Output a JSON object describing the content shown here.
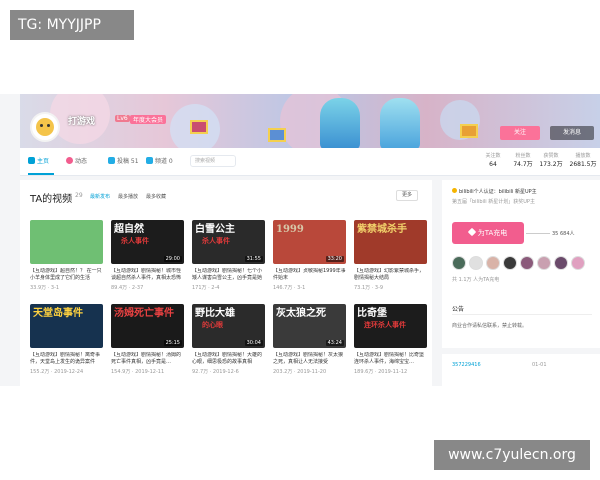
{
  "overlays": {
    "tag_top": "TG: MYYJJPP",
    "tag_bottom": "www.c7yulecn.org"
  },
  "profile": {
    "name": "打游戏",
    "level": "Lv6",
    "vip": "年度大会员",
    "follow_label": "关注",
    "message_label": "发消息"
  },
  "nav": {
    "items": [
      {
        "label": "主页",
        "color": "#00a1d6"
      },
      {
        "label": "动态",
        "color": "#f25d8e"
      },
      {
        "label": "投稿 51",
        "color": "#23ade5"
      },
      {
        "label": "频道 0",
        "color": "#23ade5"
      }
    ],
    "search_placeholder": "搜索视频",
    "stats": [
      {
        "label": "关注数",
        "value": "64"
      },
      {
        "label": "粉丝数",
        "value": "74.7万"
      },
      {
        "label": "获赞数",
        "value": "173.2万"
      },
      {
        "label": "播放数",
        "value": "2681.5万"
      }
    ]
  },
  "videos": {
    "title": "TA的视频",
    "count": "29",
    "sort": [
      "最新发布",
      "最多播放",
      "最多收藏"
    ],
    "more": "更多",
    "items": [
      {
        "thumb_title": "",
        "thumb_sub": "",
        "bg": "#6fbf73",
        "fg": "#ffffff",
        "duration": "",
        "title": "【互动游戏】超自然！？ 在一只小羊身体里成了它们的生活",
        "meta": "33.9万 · 3-1"
      },
      {
        "thumb_title": "超自然",
        "thumb_sub": "杀人事件",
        "bg": "#1c1c1c",
        "fg": "#ffffff",
        "duration": "29:00",
        "title": "【互动游戏】剧情揭秘！城市怪谈超自然杀人事件，真相太恐怖",
        "meta": "89.4万 · 2-37"
      },
      {
        "thumb_title": "白雪公主",
        "thumb_sub": "杀人事件",
        "bg": "#2a2a2a",
        "fg": "#ffffff",
        "duration": "31:55",
        "title": "【互动游戏】剧情揭秘！七个小矮人谋害白雪公主，凶手竟是她",
        "meta": "171万 · 2-4"
      },
      {
        "thumb_title": "1999",
        "thumb_sub": "",
        "bg": "#b9483a",
        "fg": "#d8c7a8",
        "duration": "33:20",
        "title": "【互动游戏】贞敏揭秘1999年事件始末",
        "meta": "146.7万 · 3-1"
      },
      {
        "thumb_title": "紫禁城杀手",
        "thumb_sub": "",
        "bg": "#a03a2a",
        "fg": "#f2d36b",
        "duration": "",
        "title": "【互动游戏】幻影紫禁城杀手，剧情揭秘大结局",
        "meta": "73.1万 · 3-9"
      },
      {
        "thumb_title": "天堂岛事件",
        "thumb_sub": "",
        "bg": "#16324f",
        "fg": "#ffd23f",
        "duration": "",
        "title": "【互动游戏】剧情揭秘！离奇事件，天堂岛上发生的诡异案件",
        "meta": "155.2万 · 2019-12-24"
      },
      {
        "thumb_title": "汤姆死亡事件",
        "thumb_sub": "",
        "bg": "#1a1a1a",
        "fg": "#e84141",
        "duration": "25:15",
        "title": "【互动游戏】剧情揭秘！汤姆的死亡事件真相，凶手竟是…",
        "meta": "154.9万 · 2019-12-11"
      },
      {
        "thumb_title": "野比大雄",
        "thumb_sub": "的心眼",
        "bg": "#2b2b2b",
        "fg": "#ffffff",
        "duration": "30:04",
        "title": "【互动游戏】剧情揭秘！大雄的心眼，细思极恐的故事真相",
        "meta": "92.7万 · 2019-12-6"
      },
      {
        "thumb_title": "灰太狼之死",
        "thumb_sub": "",
        "bg": "#3a3a3a",
        "fg": "#ffffff",
        "duration": "43:24",
        "title": "【互动游戏】剧情揭秘！灰太狼之死，真相让人无法接受",
        "meta": "203.2万 · 2019-11-20"
      },
      {
        "thumb_title": "比奇堡",
        "thumb_sub": "连环杀人事件",
        "bg": "#1c1c1c",
        "fg": "#ffffff",
        "duration": "",
        "title": "【互动游戏】剧情揭秘！比奇堡连环杀人事件，海绵宝宝…",
        "meta": "189.6万 · 2019-11-12"
      }
    ]
  },
  "side": {
    "cert": "bilibili个人认证：bilibili 新星UP主",
    "cert2": "第五届「bilibili 新星计划」获奖UP主",
    "charge_label": "为TA充电",
    "charge_count": "35 684人",
    "fans_note": "共 1.1万 人为TA充电",
    "fan_colors": [
      "#4a6b5a",
      "#e0e0e0",
      "#d9b3a8",
      "#3a3a3a",
      "#8a5a7a",
      "#c9a0b0",
      "#6a4a6a",
      "#e0a0c0"
    ],
    "notice_title": "公告",
    "notice_text": "商业合作请私信联系，禁止转载。",
    "uid": "357229416",
    "birthday": "01-01"
  },
  "colors": {
    "accent_blue": "#00a1d6",
    "accent_pink": "#fb7299"
  }
}
